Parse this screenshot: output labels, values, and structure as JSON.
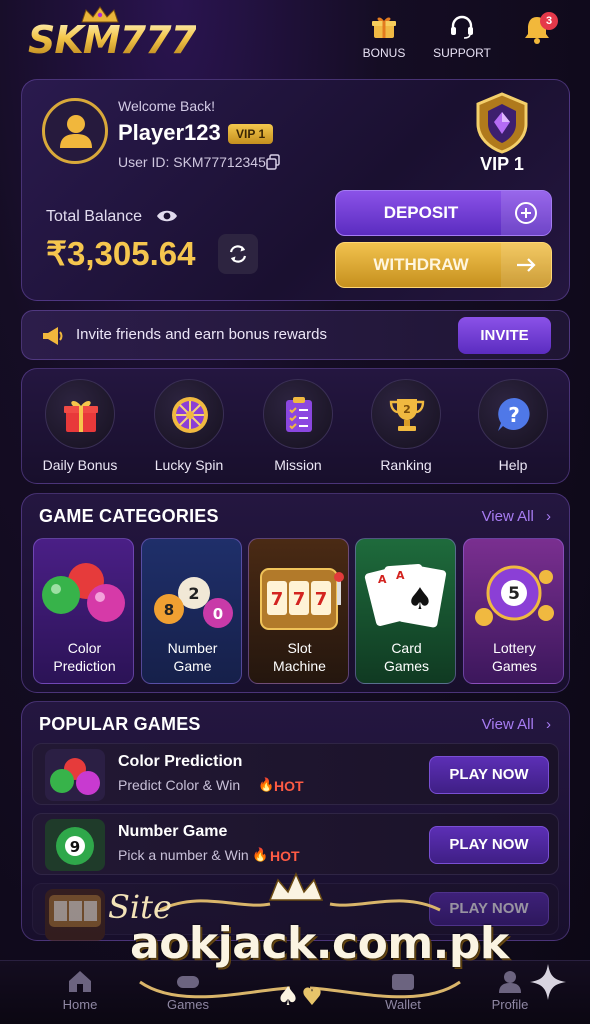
{
  "header": {
    "logo": "SKM777",
    "bonus_label": "BONUS",
    "support_label": "SUPPORT",
    "notification_count": "3"
  },
  "account": {
    "welcome": "Welcome Back!",
    "player_name": "Player123",
    "vip_chip": "VIP 1",
    "user_id": "User ID: SKM77712345",
    "vip_level": "VIP 1",
    "balance_label": "Total Balance",
    "balance_value": "₹3,305.64",
    "deposit_label": "DEPOSIT",
    "withdraw_label": "WITHDRAW"
  },
  "invite": {
    "text": "Invite friends and earn bonus rewards",
    "button": "INVITE"
  },
  "quick_actions": [
    {
      "label": "Daily Bonus",
      "icon": "gift-icon"
    },
    {
      "label": "Lucky Spin",
      "icon": "wheel-icon"
    },
    {
      "label": "Mission",
      "icon": "checklist-icon"
    },
    {
      "label": "Ranking",
      "icon": "trophy-icon"
    },
    {
      "label": "Help",
      "icon": "help-icon"
    }
  ],
  "categories": {
    "title": "GAME CATEGORIES",
    "view_all": "View All",
    "items": [
      {
        "line1": "Color",
        "line2": "Prediction"
      },
      {
        "line1": "Number",
        "line2": "Game"
      },
      {
        "line1": "Slot",
        "line2": "Machine"
      },
      {
        "line1": "Card",
        "line2": "Games"
      },
      {
        "line1": "Lottery",
        "line2": "Games"
      }
    ]
  },
  "popular": {
    "title": "POPULAR GAMES",
    "view_all": "View All",
    "games": [
      {
        "title": "Color Prediction",
        "subtitle": "Predict Color & Win",
        "badge": "HOT",
        "button": "PLAY NOW"
      },
      {
        "title": "Number Game",
        "subtitle": "Pick a number & Win",
        "badge": "HOT",
        "button": "PLAY NOW"
      },
      {
        "button": "PLAY NOW"
      }
    ]
  },
  "bottom_nav": [
    {
      "label": "Home"
    },
    {
      "label": "Games"
    },
    {
      "label": "Wallet"
    },
    {
      "label": "Profile"
    }
  ],
  "watermark": {
    "site": "Site",
    "domain": "aokjack.com.pk"
  },
  "colors": {
    "gold": "#f5c64e",
    "purple": "#7a45dc",
    "hot": "#ff5b44"
  }
}
